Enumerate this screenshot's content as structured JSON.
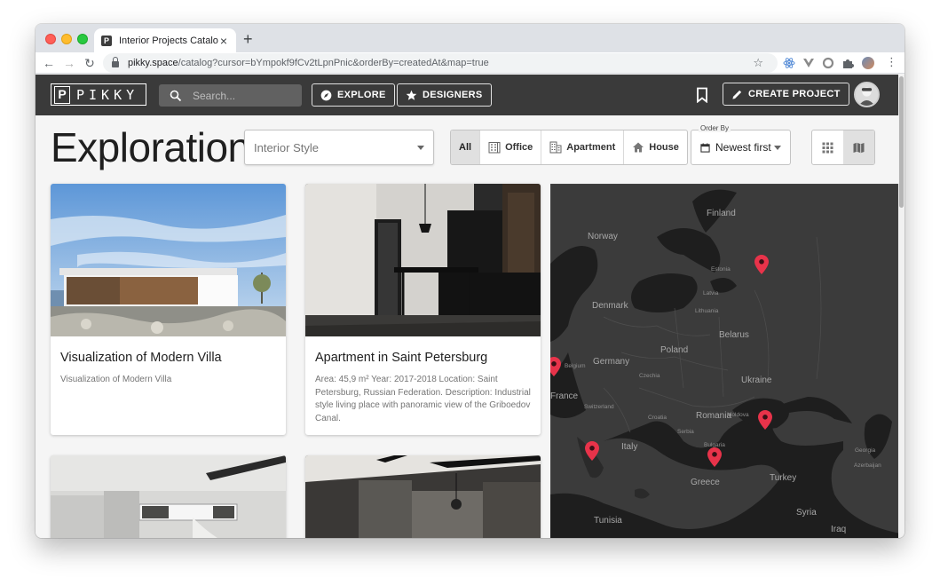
{
  "browser": {
    "tab_title": "Interior Projects Catalog",
    "favicon_letter": "P",
    "url_host": "pikky.space",
    "url_path": "/catalog?cursor=bYmpokf9fCv2tLpnPnic&orderBy=createdAt&map=true"
  },
  "appbar": {
    "logo_mark": "P",
    "logo_text": "PIKKY",
    "search_placeholder": "Search...",
    "explore_label": "EXPLORE",
    "designers_label": "DESIGNERS",
    "create_label": "CREATE PROJECT"
  },
  "filters": {
    "page_title": "Exploration",
    "style_placeholder": "Interior Style",
    "types": [
      {
        "label": "All",
        "icon": "none",
        "active": true
      },
      {
        "label": "Office",
        "icon": "office-icon",
        "active": false
      },
      {
        "label": "Apartment",
        "icon": "apartment-icon",
        "active": false
      },
      {
        "label": "House",
        "icon": "house-icon",
        "active": false
      }
    ],
    "order_label": "Order By",
    "order_value": "Newest first",
    "view_mode": "map"
  },
  "cards": [
    {
      "title": "Visualization of Modern Villa",
      "description": "Visualization of Modern Villa"
    },
    {
      "title": "Apartment in Saint Petersburg",
      "description": "Area: 45,9 m² Year: 2017-2018 Location: Saint Petersburg, Russian Federation. Description: Industrial style living place with panoramic view of the Griboedov Canal."
    }
  ],
  "map": {
    "labels": {
      "finland": "Finland",
      "norway": "Norway",
      "estonia": "Estonia",
      "latvia": "Latvia",
      "lithuania": "Lithuania",
      "denmark": "Denmark",
      "belarus": "Belarus",
      "poland": "Poland",
      "belgium": "Belgium",
      "germany": "Germany",
      "czechia": "Czechia",
      "ukraine": "Ukraine",
      "france": "France",
      "switzerland": "Switzerland",
      "moldova": "Moldova",
      "croatia": "Croatia",
      "romania": "Romania",
      "serbia": "Serbia",
      "italy": "Italy",
      "bulgaria": "Bulgaria",
      "georgia": "Georgia",
      "azerbaijan": "Azerbaijan",
      "greece": "Greece",
      "turkey": "Turkey",
      "tunisia": "Tunisia",
      "syria": "Syria",
      "iraq": "Iraq"
    },
    "pin_color": "#e8334a",
    "pin_count": 5
  },
  "colors": {
    "appbar_bg": "#3a3a3a",
    "page_bg": "#f5f5f5",
    "map_bg": "#1e1e1e",
    "land": "#3b3b3b"
  }
}
